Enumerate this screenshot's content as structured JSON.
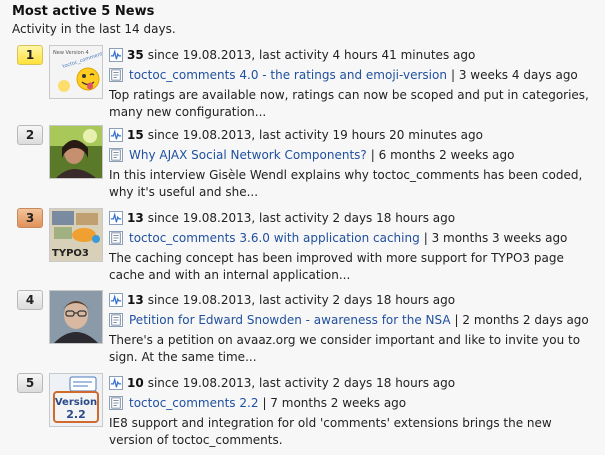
{
  "widget": {
    "title": "Most active 5 News",
    "subtitle": "Activity in the last 14 days."
  },
  "items": [
    {
      "rank": "1",
      "count": "35",
      "activity": "since 19.08.2013, last activity 4 hours 41 minutes ago",
      "article_title": "toctoc_comments 4.0 - the ratings and emoji-version",
      "article_age": "| 3 weeks 4 days ago",
      "excerpt": "Top ratings are available now, ratings can now be scoped and put in categories, many new configuration...",
      "thumb_caption": "New Version 4",
      "thumb_brand": "toctoc_comments"
    },
    {
      "rank": "2",
      "count": "15",
      "activity": "since 19.08.2013, last activity 19 hours 20 minutes ago",
      "article_title": "Why AJAX Social Network Components?",
      "article_age": "| 6 months 2 weeks ago",
      "excerpt": "In this interview Gisèle Wendl explains why toctoc_comments has been coded, why it's useful and she..."
    },
    {
      "rank": "3",
      "count": "13",
      "activity": "since 19.08.2013, last activity 2 days 18 hours ago",
      "article_title": "toctoc_comments 3.6.0 with application caching",
      "article_age": "| 3 months 3 weeks ago",
      "excerpt": "The caching concept has been improved with more support for TYPO3 page cache and with an internal application...",
      "thumb_label": "TYPO3"
    },
    {
      "rank": "4",
      "count": "13",
      "activity": "since 19.08.2013, last activity 2 days 18 hours ago",
      "article_title": "Petition for Edward Snowden - awareness for the NSA",
      "article_age": "| 2 months 2 days ago",
      "excerpt": "There's a petition on avaaz.org we consider important and like to invite you to sign. At the same time..."
    },
    {
      "rank": "5",
      "count": "10",
      "activity": "since 19.08.2013, last activity 2 days 18 hours ago",
      "article_title": "toctoc_comments 2.2",
      "article_age": "| 7 months 2 weeks ago",
      "excerpt": "IE8 support and integration for old 'comments' extensions brings the new version of toctoc_comments.",
      "thumb_version": "Version",
      "thumb_number": "2.2"
    }
  ],
  "icons": {
    "activity": "activity-pulse-icon",
    "article": "article-document-icon"
  },
  "colors": {
    "link": "#1f4f9e",
    "rank_gold": "#ffe13a",
    "rank_bronze": "#e0915a",
    "rank_default": "#dcdcdc"
  }
}
